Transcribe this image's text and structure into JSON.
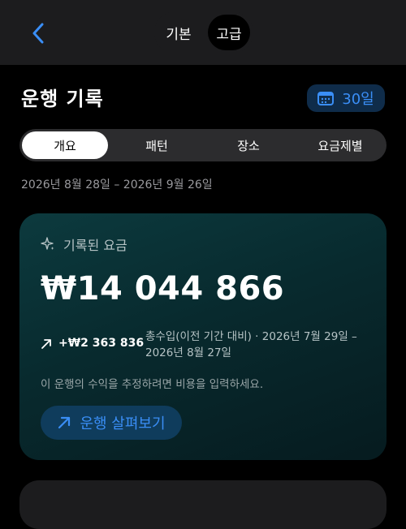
{
  "header": {
    "segments": [
      "기본",
      "고급"
    ],
    "selected_segment": "고급"
  },
  "title": "운행 기록",
  "range_button": {
    "label": "30일"
  },
  "tabs": [
    "개요",
    "패턴",
    "장소",
    "요금제별"
  ],
  "selected_tab": "개요",
  "date_range": "2026년 8월 28일 – 2026년 9월 26일",
  "card": {
    "heading": "기록된 요금",
    "amount": "₩14 044 866",
    "delta": "+₩2 363 836",
    "delta_desc": "총수입(이전 기간 대비) · 2026년 7월 29일 – 2026년 8월 27일",
    "hint": "이 운행의 수익을 추정하려면 비용을 입력하세요.",
    "explore_button": "운행 살펴보기"
  },
  "colors": {
    "accent": "#3a8ef6",
    "card_teal": "#0c3a3e",
    "background": "#000000"
  }
}
